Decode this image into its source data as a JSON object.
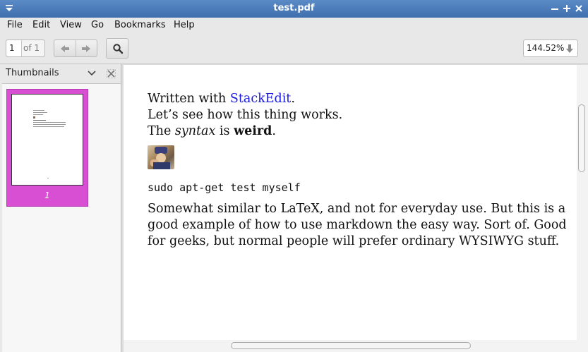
{
  "window": {
    "title": "test.pdf",
    "controls": [
      "minimize",
      "maximize",
      "close"
    ]
  },
  "menu": [
    "File",
    "Edit",
    "View",
    "Go",
    "Bookmarks",
    "Help"
  ],
  "toolbar": {
    "page_current": "1",
    "page_total": "of 1",
    "zoom": "144.52%"
  },
  "sidebar": {
    "title": "Thumbnails",
    "thumbnails": [
      {
        "page_label": "1"
      }
    ]
  },
  "document": {
    "line1_prefix": "Written with ",
    "line1_link": "StackEdit",
    "line1_suffix": ".",
    "line2": "Let’s see how this thing works.",
    "line3_a": "The ",
    "line3_italic": "syntax",
    "line3_b": " is ",
    "line3_bold": "weird",
    "line3_c": ".",
    "code_line": "sudo apt-get test myself",
    "para_line1": "Somewhat similar to LaTeX, and not for everyday use.  But this is a",
    "para_line2": "good example of how to use markdown the easy way.  Sort of.  Good",
    "para_line3": "for geeks, but normal people will prefer ordinary WYSIWYG stuff."
  },
  "icons": {
    "window_menu": "window-menu-icon",
    "back": "arrow-left-icon",
    "forward": "arrow-right-icon",
    "search": "search-icon",
    "zoom_dropdown": "arrow-down-icon",
    "sidebar_dropdown": "chevron-down-icon",
    "sidebar_close": "close-icon"
  },
  "colors": {
    "titlebar": "#4a7cbc",
    "thumbnail_selected": "#d94fd4",
    "link": "#1a1adb"
  }
}
